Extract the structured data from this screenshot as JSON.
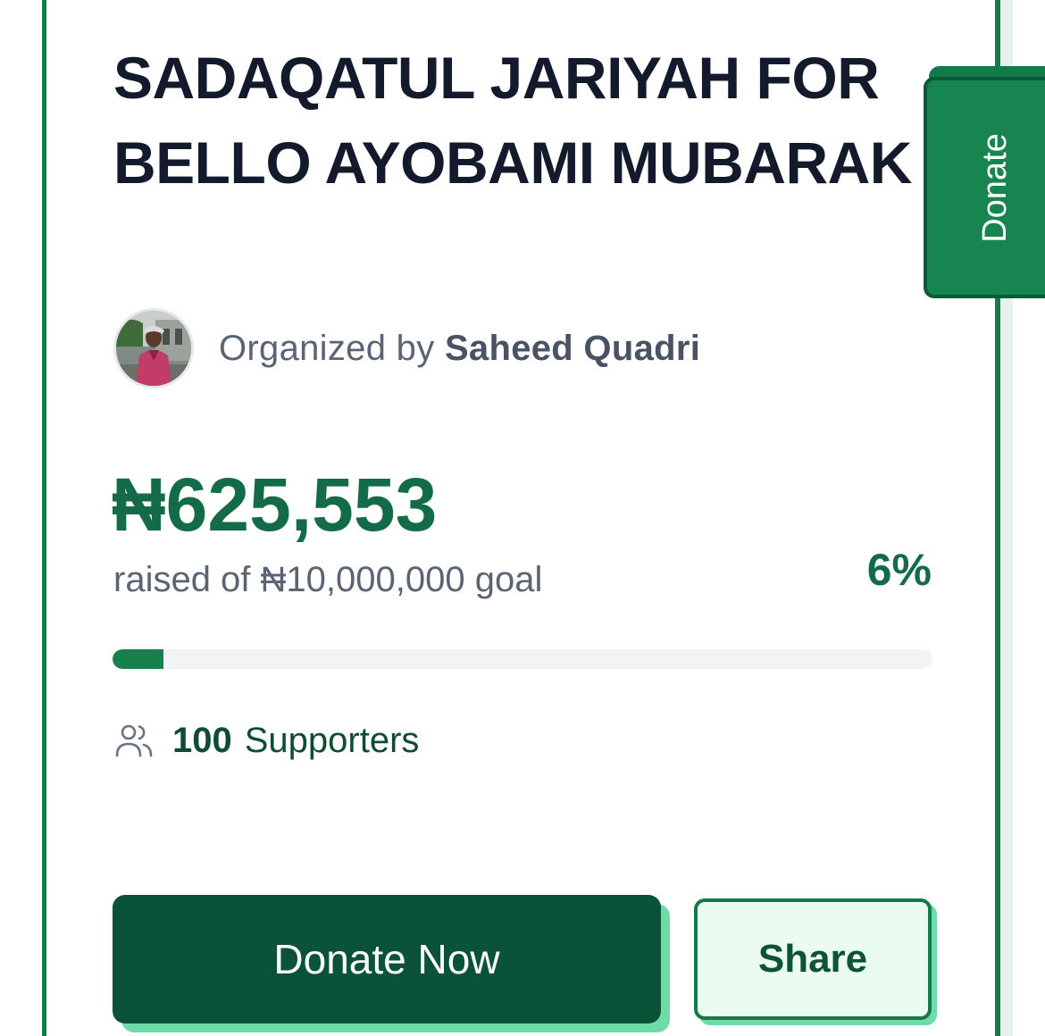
{
  "campaign": {
    "title": "SADAQATUL JARIYAH FOR BELLO AYOBAMI MUBARAK",
    "organizer_prefix": "Organized by",
    "organizer_name": "Saheed Quadri",
    "raised_amount": "₦625,553",
    "goal_text": "raised of ₦10,000,000 goal",
    "percent_label": "6%",
    "progress_fraction": 0.0626,
    "supporters_count": "100",
    "supporters_label": "Supporters"
  },
  "actions": {
    "donate_now_label": "Donate Now",
    "share_label": "Share",
    "side_donate_label": "Donate"
  },
  "icons": {
    "supporters": "users-icon",
    "avatar": "organizer-avatar"
  },
  "colors": {
    "brand_green": "#137a4a",
    "dark_green": "#0a5238",
    "amount_green": "#136b47",
    "accent_mint": "#6fdba8",
    "title_text": "#121a2b",
    "muted_text": "#5b6473"
  }
}
